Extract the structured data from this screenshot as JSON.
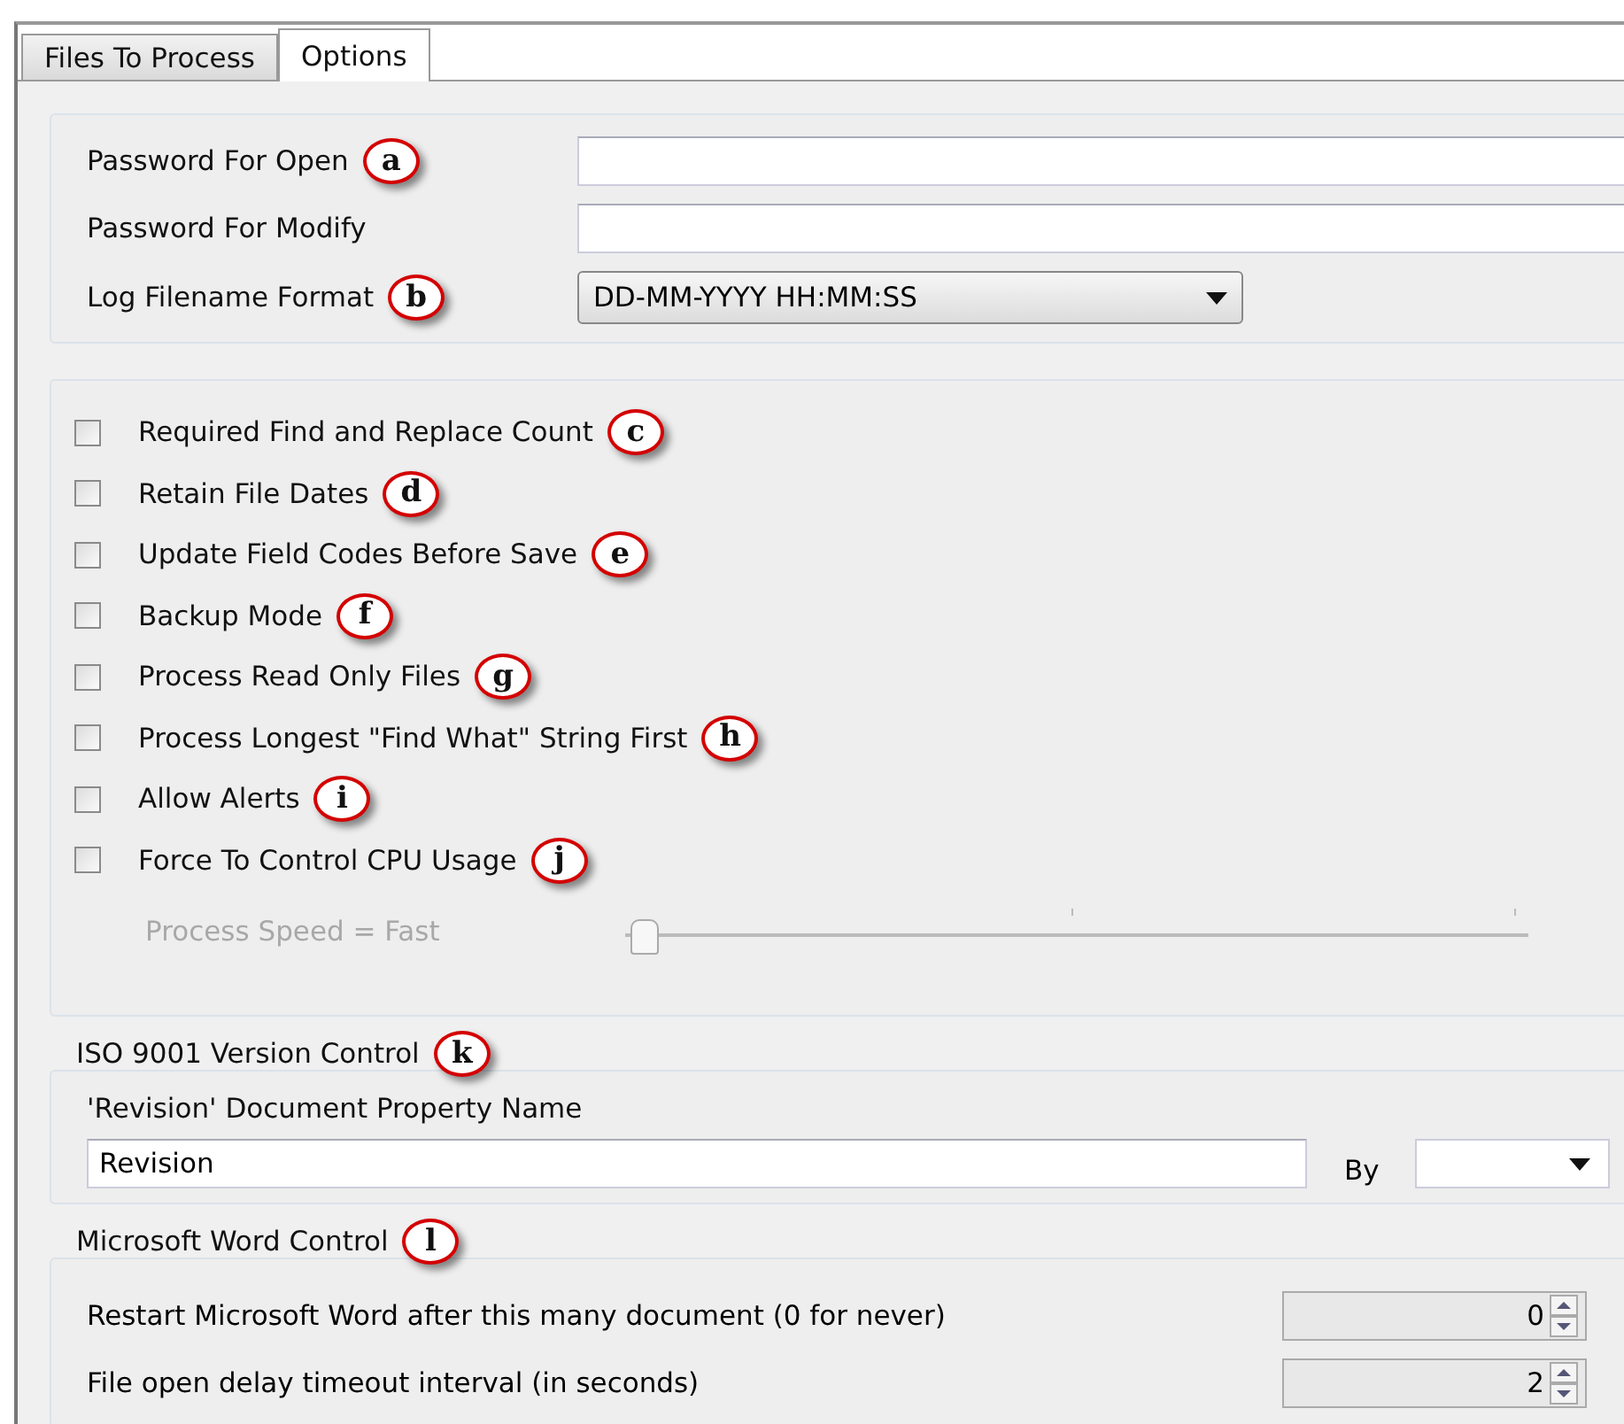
{
  "tabs": [
    {
      "label": "Files To Process",
      "selected": false
    },
    {
      "label": "Options",
      "selected": true
    }
  ],
  "passwords": {
    "fields": [
      {
        "label": "Password For Open",
        "marker": "a"
      },
      {
        "label": "Password For Modify"
      }
    ],
    "log_format": {
      "label": "Log Filename Format",
      "marker": "b",
      "value": "DD-MM-YYYY HH:MM:SS"
    }
  },
  "options": [
    {
      "label": "Required Find and Replace Count",
      "marker": "c",
      "checked": false
    },
    {
      "label": "Retain File Dates",
      "marker": "d",
      "checked": false
    },
    {
      "label": "Update Field Codes Before Save",
      "marker": "e",
      "checked": false
    },
    {
      "label": "Backup Mode",
      "marker": "f",
      "checked": false
    },
    {
      "label": "Process Read Only Files",
      "marker": "g",
      "checked": false
    },
    {
      "label": "Process Longest \"Find What\" String First",
      "marker": "h",
      "checked": false
    },
    {
      "label": "Allow Alerts",
      "marker": "i",
      "checked": false
    },
    {
      "label": "Force To Control CPU Usage",
      "marker": "j",
      "checked": false
    }
  ],
  "speed": {
    "label": "Process Speed = Fast",
    "disabled": true,
    "level": 0
  },
  "iso": {
    "title": "ISO 9001 Version Control",
    "marker": "k",
    "property_label": "'Revision' Document Property Name",
    "property_value": "Revision",
    "by_label": "By"
  },
  "word": {
    "title": "Microsoft Word Control",
    "marker": "l",
    "rows": [
      {
        "label": "Restart Microsoft Word after this many document (0 for never)",
        "value": "0"
      },
      {
        "label": "File open delay timeout interval (in seconds)",
        "value": "2"
      }
    ]
  }
}
